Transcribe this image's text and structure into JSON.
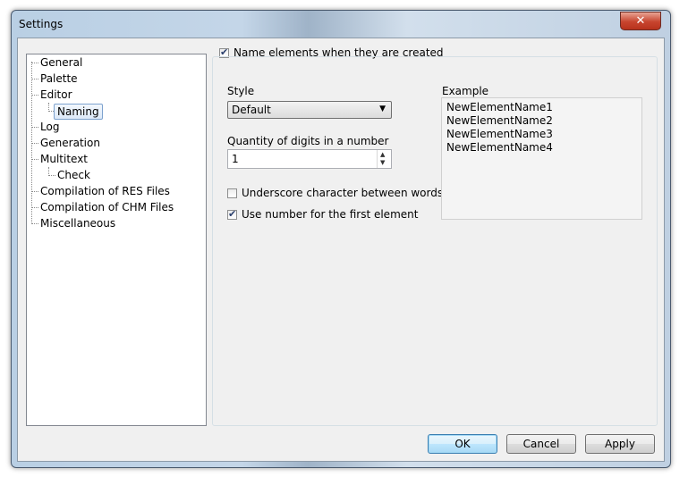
{
  "window": {
    "title": "Settings",
    "close_glyph": "✕"
  },
  "tree": {
    "items": [
      {
        "label": "General"
      },
      {
        "label": "Palette"
      },
      {
        "label": "Editor"
      },
      {
        "label": "Naming"
      },
      {
        "label": "Log"
      },
      {
        "label": "Generation"
      },
      {
        "label": "Multitext"
      },
      {
        "label": "Check"
      },
      {
        "label": "Compilation of RES Files"
      },
      {
        "label": "Compilation of CHM Files"
      },
      {
        "label": "Miscellaneous"
      }
    ],
    "selected": "Naming"
  },
  "naming": {
    "enable_label": "Name elements when they are created",
    "enable_checked": true,
    "style_label": "Style",
    "style_value": "Default",
    "digits_label": "Quantity of digits in a number",
    "digits_value": "1",
    "underscore_label": "Underscore character between words",
    "underscore_checked": false,
    "first_number_label": "Use number for the first element",
    "first_number_checked": true,
    "example_label": "Example",
    "example_lines": [
      "NewElementName1",
      "NewElementName2",
      "NewElementName3",
      "NewElementName4"
    ]
  },
  "buttons": {
    "ok": "OK",
    "cancel": "Cancel",
    "apply": "Apply"
  },
  "icons": {
    "check": "✔",
    "dropdown": "▼",
    "spin_up": "▲",
    "spin_down": "▼"
  }
}
